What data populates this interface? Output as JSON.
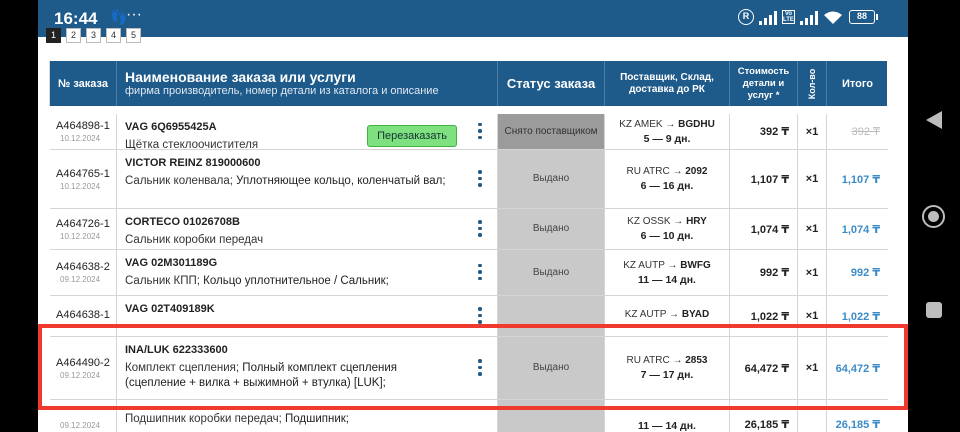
{
  "status_bar": {
    "time": "16:44",
    "battery": "88",
    "icons": [
      "footsteps-icon",
      "more-icon",
      "r-circle-icon",
      "signal-icon",
      "volte-icon",
      "signal2-icon",
      "wifi-icon",
      "battery-icon"
    ]
  },
  "pager": [
    "1",
    "2",
    "3",
    "4",
    "5"
  ],
  "table": {
    "headers": {
      "id": "№ заказа",
      "name_title": "Наименование заказа или услуги",
      "name_sub": "фирма производитель, номер детали из каталога и описание",
      "status": "Статус заказа",
      "supplier": "Поставщик, Склад, доставка до РК",
      "cost": "Стоимость детали и услуг *",
      "qty": "Кол-во",
      "total": "Итого"
    },
    "reorder_label": "Перезаказать",
    "rows": [
      {
        "id": "A464898-1",
        "date": "10.12.2024",
        "title": "VAG 6Q6955425A",
        "desc": "Щётка стеклоочистителя",
        "status": "Снято поставщиком",
        "route_from": "KZ AMEK",
        "route_to": "BGDHU",
        "days": "5 — 9 дн.",
        "cost": "392 ₸",
        "qty": "×1",
        "total": "392 ₸"
      },
      {
        "id": "A464765-1",
        "date": "10.12.2024",
        "title": "VICTOR REINZ 819000600",
        "desc_a": "Сальник коленвала; ",
        "desc_b": "Уплотняющее кольцо, коленчатый вал;",
        "status": "Выдано",
        "route_from": "RU ATRC",
        "route_to": "2092",
        "days": "6 — 16 дн.",
        "cost": "1,107 ₸",
        "qty": "×1",
        "total": "1,107 ₸"
      },
      {
        "id": "A464726-1",
        "date": "10.12.2024",
        "title": "CORTECO 01026708B",
        "desc": "Сальник коробки передач",
        "status": "Выдано",
        "route_from": "KZ OSSK",
        "route_to": "HRY",
        "days": "6 — 10 дн.",
        "cost": "1,074 ₸",
        "qty": "×1",
        "total": "1,074 ₸"
      },
      {
        "id": "A464638-2",
        "date": "09.12.2024",
        "title": "VAG 02M301189G",
        "desc_a": "Сальник КПП; ",
        "desc_b": "Кольцо уплотнительное / Сальник;",
        "status": "Выдано",
        "route_from": "KZ AUTP",
        "route_to": "BWFG",
        "days": "11 — 14 дн.",
        "cost": "992 ₸",
        "qty": "×1",
        "total": "992 ₸"
      },
      {
        "id": "A464638-1",
        "date": "",
        "title": "VAG 02T409189K",
        "desc": "",
        "status": "",
        "route_from": "KZ AUTP",
        "route_to": "BYAD",
        "days": "",
        "cost": "1,022 ₸",
        "qty": "×1",
        "total": "1,022 ₸"
      },
      {
        "id": "A464490-2",
        "date": "09.12.2024",
        "title": "INA/LUK 622333600",
        "desc_a": "Комплект сцепления; ",
        "desc_b": "Полный комплект сцепления (сцепление + вилка + выжимной + втулка) [LUK];",
        "status": "Выдано",
        "route_from": "RU ATRC",
        "route_to": "2853",
        "days": "7 — 17 дн.",
        "cost": "64,472 ₸",
        "qty": "×1",
        "total": "64,472 ₸"
      },
      {
        "id": "",
        "date": "09.12.2024",
        "title": "",
        "desc_a": "Подшипник коробки передач; ",
        "desc_b": "Подшипник;",
        "status": "",
        "route_from": "",
        "route_to": "",
        "days": "11 — 14 дн.",
        "cost": "26,185 ₸",
        "qty": "",
        "total": "26,185 ₸"
      }
    ]
  }
}
